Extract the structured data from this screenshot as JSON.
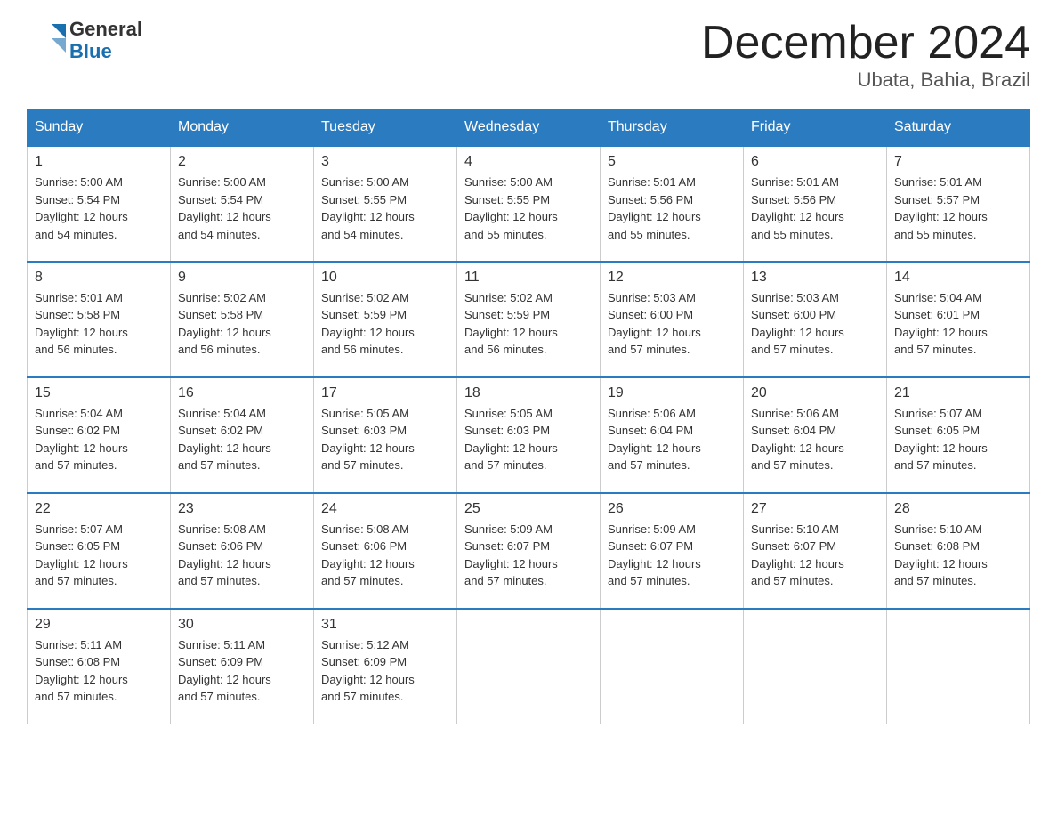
{
  "logo": {
    "general": "General",
    "blue": "Blue",
    "arrow_symbol": "▶"
  },
  "title": "December 2024",
  "subtitle": "Ubata, Bahia, Brazil",
  "headers": [
    "Sunday",
    "Monday",
    "Tuesday",
    "Wednesday",
    "Thursday",
    "Friday",
    "Saturday"
  ],
  "weeks": [
    [
      {
        "day": "1",
        "sunrise": "5:00 AM",
        "sunset": "5:54 PM",
        "daylight": "12 hours and 54 minutes."
      },
      {
        "day": "2",
        "sunrise": "5:00 AM",
        "sunset": "5:54 PM",
        "daylight": "12 hours and 54 minutes."
      },
      {
        "day": "3",
        "sunrise": "5:00 AM",
        "sunset": "5:55 PM",
        "daylight": "12 hours and 54 minutes."
      },
      {
        "day": "4",
        "sunrise": "5:00 AM",
        "sunset": "5:55 PM",
        "daylight": "12 hours and 55 minutes."
      },
      {
        "day": "5",
        "sunrise": "5:01 AM",
        "sunset": "5:56 PM",
        "daylight": "12 hours and 55 minutes."
      },
      {
        "day": "6",
        "sunrise": "5:01 AM",
        "sunset": "5:56 PM",
        "daylight": "12 hours and 55 minutes."
      },
      {
        "day": "7",
        "sunrise": "5:01 AM",
        "sunset": "5:57 PM",
        "daylight": "12 hours and 55 minutes."
      }
    ],
    [
      {
        "day": "8",
        "sunrise": "5:01 AM",
        "sunset": "5:58 PM",
        "daylight": "12 hours and 56 minutes."
      },
      {
        "day": "9",
        "sunrise": "5:02 AM",
        "sunset": "5:58 PM",
        "daylight": "12 hours and 56 minutes."
      },
      {
        "day": "10",
        "sunrise": "5:02 AM",
        "sunset": "5:59 PM",
        "daylight": "12 hours and 56 minutes."
      },
      {
        "day": "11",
        "sunrise": "5:02 AM",
        "sunset": "5:59 PM",
        "daylight": "12 hours and 56 minutes."
      },
      {
        "day": "12",
        "sunrise": "5:03 AM",
        "sunset": "6:00 PM",
        "daylight": "12 hours and 57 minutes."
      },
      {
        "day": "13",
        "sunrise": "5:03 AM",
        "sunset": "6:00 PM",
        "daylight": "12 hours and 57 minutes."
      },
      {
        "day": "14",
        "sunrise": "5:04 AM",
        "sunset": "6:01 PM",
        "daylight": "12 hours and 57 minutes."
      }
    ],
    [
      {
        "day": "15",
        "sunrise": "5:04 AM",
        "sunset": "6:02 PM",
        "daylight": "12 hours and 57 minutes."
      },
      {
        "day": "16",
        "sunrise": "5:04 AM",
        "sunset": "6:02 PM",
        "daylight": "12 hours and 57 minutes."
      },
      {
        "day": "17",
        "sunrise": "5:05 AM",
        "sunset": "6:03 PM",
        "daylight": "12 hours and 57 minutes."
      },
      {
        "day": "18",
        "sunrise": "5:05 AM",
        "sunset": "6:03 PM",
        "daylight": "12 hours and 57 minutes."
      },
      {
        "day": "19",
        "sunrise": "5:06 AM",
        "sunset": "6:04 PM",
        "daylight": "12 hours and 57 minutes."
      },
      {
        "day": "20",
        "sunrise": "5:06 AM",
        "sunset": "6:04 PM",
        "daylight": "12 hours and 57 minutes."
      },
      {
        "day": "21",
        "sunrise": "5:07 AM",
        "sunset": "6:05 PM",
        "daylight": "12 hours and 57 minutes."
      }
    ],
    [
      {
        "day": "22",
        "sunrise": "5:07 AM",
        "sunset": "6:05 PM",
        "daylight": "12 hours and 57 minutes."
      },
      {
        "day": "23",
        "sunrise": "5:08 AM",
        "sunset": "6:06 PM",
        "daylight": "12 hours and 57 minutes."
      },
      {
        "day": "24",
        "sunrise": "5:08 AM",
        "sunset": "6:06 PM",
        "daylight": "12 hours and 57 minutes."
      },
      {
        "day": "25",
        "sunrise": "5:09 AM",
        "sunset": "6:07 PM",
        "daylight": "12 hours and 57 minutes."
      },
      {
        "day": "26",
        "sunrise": "5:09 AM",
        "sunset": "6:07 PM",
        "daylight": "12 hours and 57 minutes."
      },
      {
        "day": "27",
        "sunrise": "5:10 AM",
        "sunset": "6:07 PM",
        "daylight": "12 hours and 57 minutes."
      },
      {
        "day": "28",
        "sunrise": "5:10 AM",
        "sunset": "6:08 PM",
        "daylight": "12 hours and 57 minutes."
      }
    ],
    [
      {
        "day": "29",
        "sunrise": "5:11 AM",
        "sunset": "6:08 PM",
        "daylight": "12 hours and 57 minutes."
      },
      {
        "day": "30",
        "sunrise": "5:11 AM",
        "sunset": "6:09 PM",
        "daylight": "12 hours and 57 minutes."
      },
      {
        "day": "31",
        "sunrise": "5:12 AM",
        "sunset": "6:09 PM",
        "daylight": "12 hours and 57 minutes."
      },
      null,
      null,
      null,
      null
    ]
  ],
  "labels": {
    "sunrise": "Sunrise:",
    "sunset": "Sunset:",
    "daylight": "Daylight:"
  }
}
